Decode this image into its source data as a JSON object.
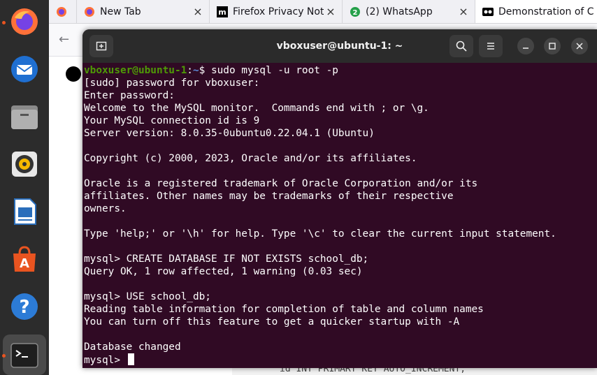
{
  "browser": {
    "tabs": [
      {
        "title": "New Tab"
      },
      {
        "title": "Firefox Privacy Noti"
      },
      {
        "title": "(2) WhatsApp",
        "badge": "2"
      },
      {
        "title": "Demonstration of C"
      }
    ],
    "peek_code": "id INT PRIMARY KEY AUTO_INCREMENT,"
  },
  "dock": {
    "apps": [
      "firefox-icon",
      "thunderbird-icon",
      "files-icon",
      "rhythmbox-icon",
      "libreoffice-writer-icon",
      "app-center-icon",
      "help-icon",
      "terminal-icon"
    ]
  },
  "terminal": {
    "title": "vboxuser@ubuntu-1: ~",
    "prompt_user": "vboxuser@ubuntu-1",
    "prompt_sep": ":",
    "prompt_path": "~",
    "prompt_end": "$ ",
    "first_command": "sudo mysql -u root -p",
    "lines": [
      "[sudo] password for vboxuser:",
      "Enter password:",
      "Welcome to the MySQL monitor.  Commands end with ; or \\g.",
      "Your MySQL connection id is 9",
      "Server version: 8.0.35-0ubuntu0.22.04.1 (Ubuntu)",
      "",
      "Copyright (c) 2000, 2023, Oracle and/or its affiliates.",
      "",
      "Oracle is a registered trademark of Oracle Corporation and/or its",
      "affiliates. Other names may be trademarks of their respective",
      "owners.",
      "",
      "Type 'help;' or '\\h' for help. Type '\\c' to clear the current input statement.",
      "",
      "mysql> CREATE DATABASE IF NOT EXISTS school_db;",
      "Query OK, 1 row affected, 1 warning (0.03 sec)",
      "",
      "mysql> USE school_db;",
      "Reading table information for completion of table and column names",
      "You can turn off this feature to get a quicker startup with -A",
      "",
      "Database changed"
    ],
    "final_prompt": "mysql> "
  },
  "colors": {
    "terminal_bg": "#300a24",
    "header_bg": "#2b2b2b",
    "prompt_user": "#4e9a06",
    "prompt_path": "#5c88d6",
    "dock_bg": "#2c2c2c",
    "accent": "#e95420"
  }
}
